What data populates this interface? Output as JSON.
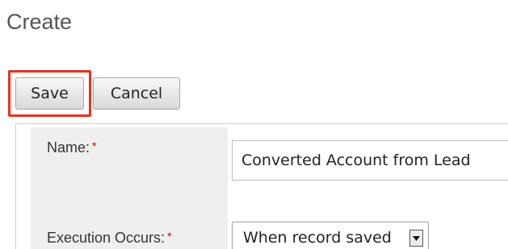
{
  "page": {
    "title": "Create"
  },
  "toolbar": {
    "save_label": "Save",
    "cancel_label": "Cancel"
  },
  "form": {
    "name_label": "Name:",
    "name_required": "*",
    "name_value": "Converted Account from Lead",
    "execution_label": "Execution Occurs:",
    "execution_required": "*",
    "execution_selected": "When record saved"
  },
  "colors": {
    "highlight": "#e8321e",
    "required_marker": "#cc0000",
    "label_column_bg": "#efefef"
  }
}
